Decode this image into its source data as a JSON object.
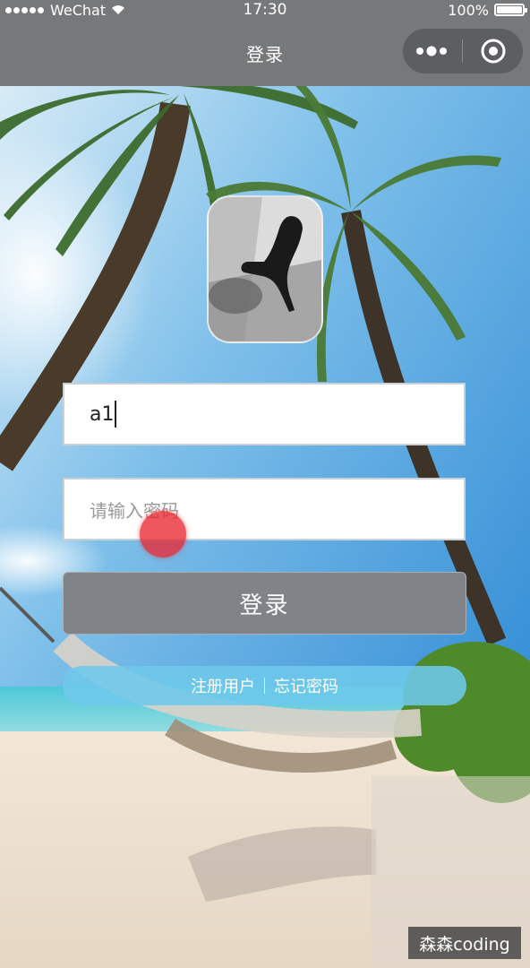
{
  "status_bar": {
    "carrier": "WeChat",
    "time": "17:30",
    "battery": "100%"
  },
  "nav_bar": {
    "title": "登录"
  },
  "form": {
    "username_value": "a1",
    "password_placeholder": "请输入密码",
    "login_button_label": "登录"
  },
  "links": {
    "register_label": "注册用户",
    "forgot_label": "忘记密码"
  },
  "watermark": "森森coding",
  "colors": {
    "nav_bg": "#77787a",
    "login_button_bg": "#808388",
    "links_bar_bg": "#6ec8eb",
    "touch_indicator": "#eb2832"
  }
}
